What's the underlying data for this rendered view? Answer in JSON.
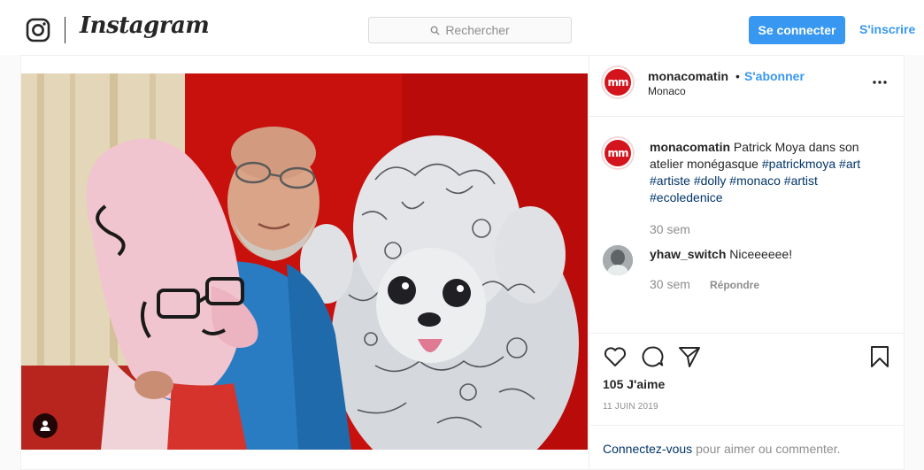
{
  "header": {
    "wordmark": "Instagram",
    "search_placeholder": "Rechercher",
    "login_label": "Se connecter",
    "signup_label": "S'inscrire"
  },
  "post": {
    "author": {
      "username": "monacomatin",
      "avatar_text": "mm",
      "follow_label": "S'abonner",
      "separator": "•",
      "location": "Monaco"
    },
    "caption": {
      "username": "monacomatin",
      "text": "Patrick Moya dans son atelier monégasque",
      "hashtags": [
        "#patrickmoya",
        "#art",
        "#artiste",
        "#dolly",
        "#monaco",
        "#artist",
        "#ecoledenice"
      ],
      "age": "30 sem"
    },
    "comments": [
      {
        "username": "yhaw_switch",
        "text": "Niceeeeee!",
        "age": "30 sem",
        "reply_label": "Répondre"
      }
    ],
    "likes": "105 J'aime",
    "date": "11 JUIN 2019",
    "login_prompt": {
      "link": "Connectez-vous",
      "rest": "pour aimer ou commenter."
    }
  },
  "icons": {
    "logo": "instagram-glyph-icon",
    "search": "search-icon",
    "more": "more-options-icon",
    "like": "heart-icon",
    "comment": "comment-icon",
    "share": "share-icon",
    "save": "bookmark-icon",
    "tags": "user-tag-icon"
  },
  "colors": {
    "accent": "#3897f0",
    "hashtag": "#003569",
    "muted": "#8e8e8e",
    "brand_red": "#d4141c"
  }
}
